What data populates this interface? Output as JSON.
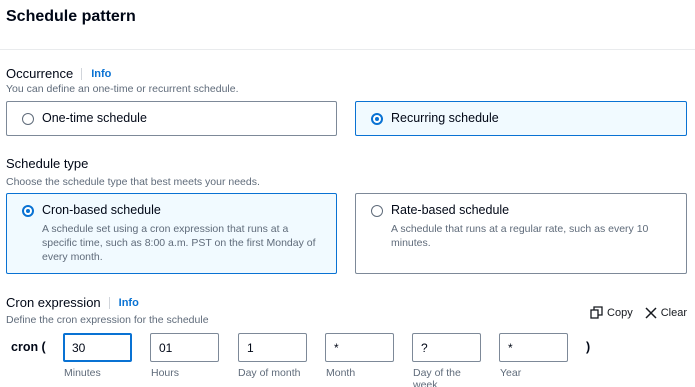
{
  "header": {
    "title": "Schedule pattern"
  },
  "occurrence": {
    "label": "Occurrence",
    "info": "Info",
    "description": "You can define an one-time or recurrent schedule.",
    "options": [
      {
        "label": "One-time schedule",
        "selected": false
      },
      {
        "label": "Recurring schedule",
        "selected": true
      }
    ]
  },
  "schedule_type": {
    "label": "Schedule type",
    "description": "Choose the schedule type that best meets your needs.",
    "options": [
      {
        "label": "Cron-based schedule",
        "description": "A schedule set using a cron expression that runs at a specific time, such as 8:00 a.m. PST on the first Monday of every month.",
        "selected": true
      },
      {
        "label": "Rate-based schedule",
        "description": "A schedule that runs at a regular rate, such as every 10 minutes.",
        "selected": false
      }
    ]
  },
  "cron": {
    "label": "Cron expression",
    "info": "Info",
    "description": "Define the cron expression for the schedule",
    "copy_label": "Copy",
    "clear_label": "Clear",
    "prefix": "cron (",
    "suffix": ")",
    "fields": [
      {
        "value": "30",
        "label": "Minutes"
      },
      {
        "value": "01",
        "label": "Hours"
      },
      {
        "value": "1",
        "label": "Day of month"
      },
      {
        "value": "*",
        "label": "Month"
      },
      {
        "value": "?",
        "label": "Day of the week"
      },
      {
        "value": "*",
        "label": "Year"
      }
    ]
  },
  "colors": {
    "accent": "#0972d3",
    "selected_bg": "#f1faff",
    "border": "#7d8998",
    "muted_text": "#5f6b7a"
  }
}
